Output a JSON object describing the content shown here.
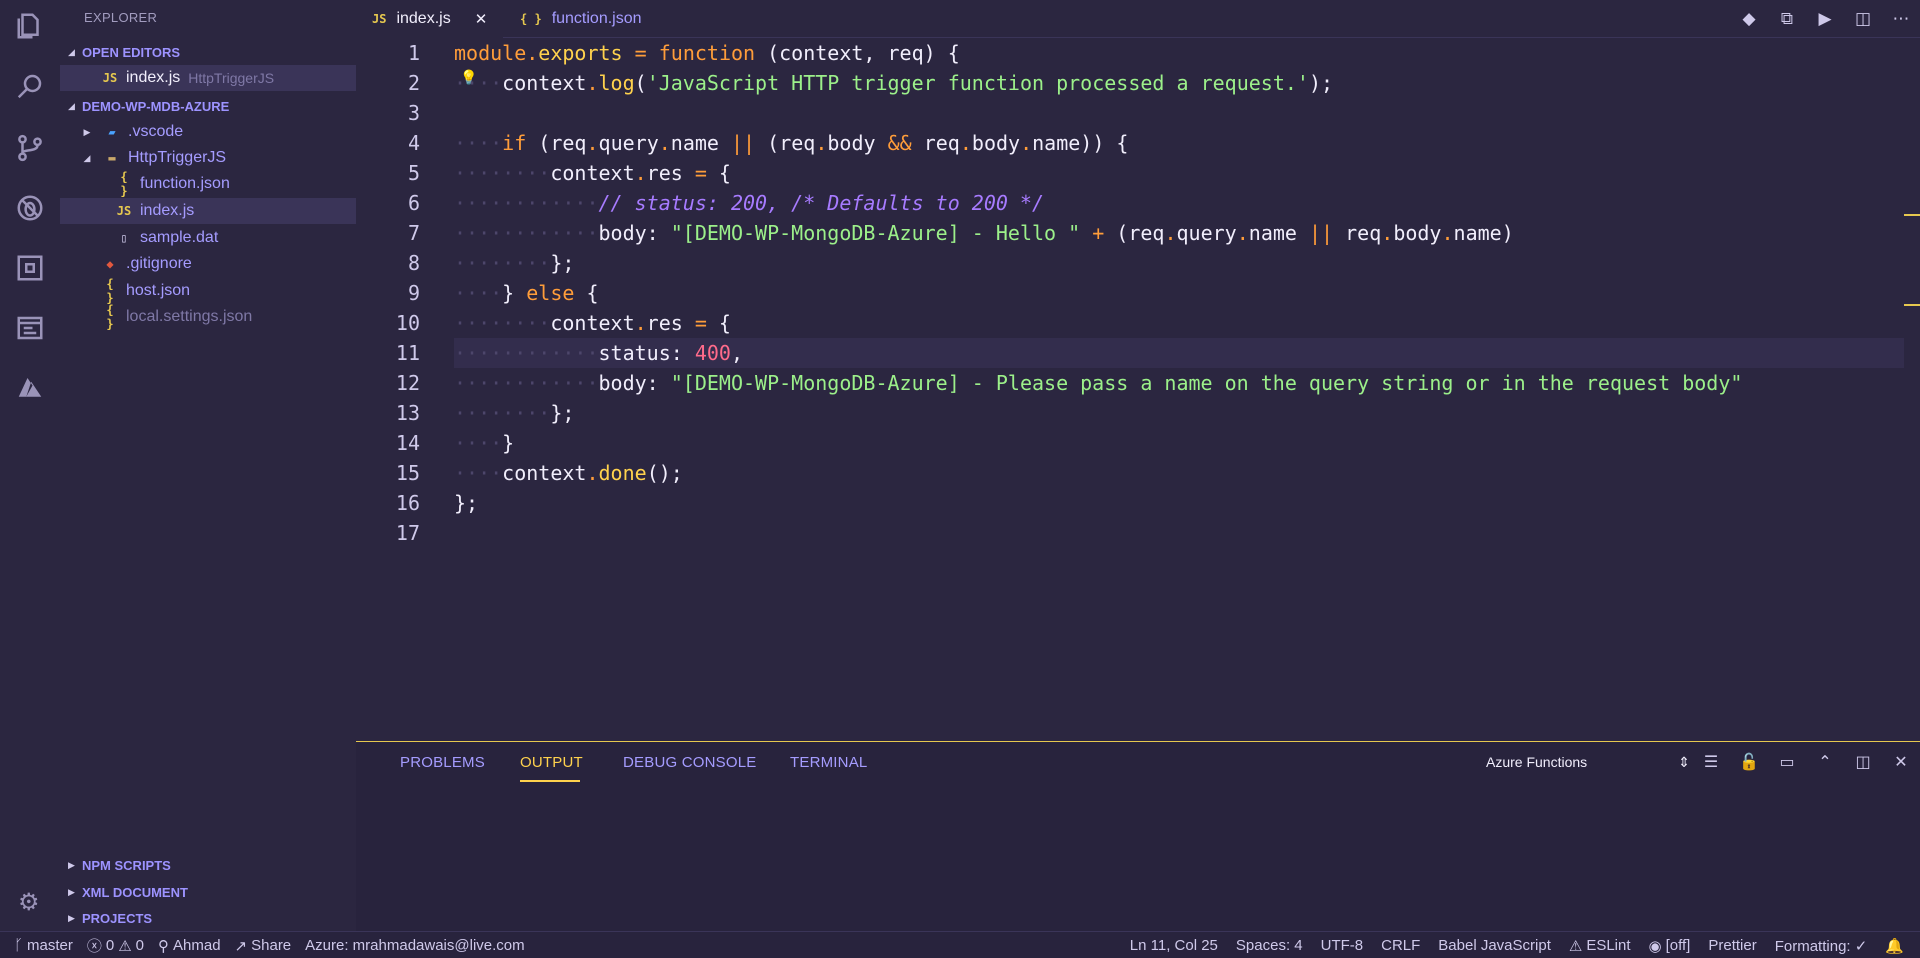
{
  "sidebar": {
    "title": "EXPLORER",
    "open_editors": {
      "label": "OPEN EDITORS",
      "items": [
        {
          "icon": "JS",
          "name": "index.js",
          "hint": "HttpTriggerJS"
        }
      ]
    },
    "project": {
      "label": "DEMO-WP-MDB-AZURE",
      "items": [
        {
          "icon": "vscode-folder-icon",
          "name": ".vscode"
        },
        {
          "icon": "folder-open-icon",
          "name": "HttpTriggerJS"
        },
        {
          "icon": "{ }",
          "name": "function.json"
        },
        {
          "icon": "JS",
          "name": "index.js"
        },
        {
          "icon": "file-icon",
          "name": "sample.dat"
        },
        {
          "icon": "git-icon",
          "name": ".gitignore"
        },
        {
          "icon": "{ }",
          "name": "host.json"
        },
        {
          "icon": "{ }",
          "name": "local.settings.json"
        }
      ]
    },
    "bottom_sections": [
      "NPM SCRIPTS",
      "XML DOCUMENT",
      "PROJECTS"
    ]
  },
  "tabs": [
    {
      "icon": "JS",
      "label": "index.js",
      "active": true
    },
    {
      "icon": "{ }",
      "label": "function.json",
      "active": false
    }
  ],
  "editor": {
    "line_numbers": [
      "1",
      "2",
      "3",
      "4",
      "5",
      "6",
      "7",
      "8",
      "9",
      "10",
      "11",
      "12",
      "13",
      "14",
      "15",
      "16",
      "17"
    ],
    "current_line": 11
  },
  "panel": {
    "tabs": [
      "PROBLEMS",
      "OUTPUT",
      "DEBUG CONSOLE",
      "TERMINAL"
    ],
    "active_tab": "OUTPUT",
    "output_channel": "Azure Functions"
  },
  "status": {
    "branch": "master",
    "errors": "0",
    "warnings": "0",
    "user": "Ahmad",
    "share": "Share",
    "azure": "Azure: mrahmadawais@live.com",
    "position": "Ln 11, Col 25",
    "spaces": "Spaces: 4",
    "encoding": "UTF-8",
    "eol": "CRLF",
    "language": "Babel JavaScript",
    "eslint": "ESLint",
    "live": "[off]",
    "prettier": "Prettier",
    "formatting": "Formatting: ✓"
  },
  "colors": {
    "background": "#2b2640",
    "accent": "#ffd24d",
    "section": "#9d93ff"
  }
}
